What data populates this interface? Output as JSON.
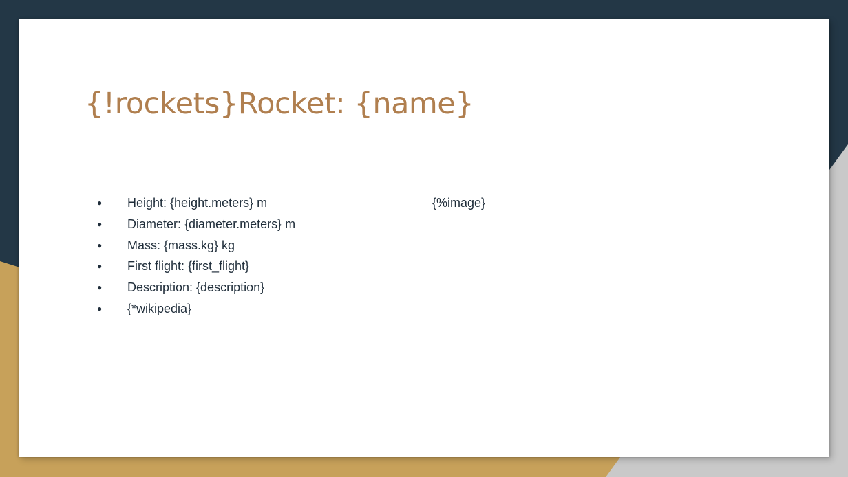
{
  "slide": {
    "title": "{!rockets}Rocket: {name}",
    "bullets": [
      "Height: {height.meters} m",
      "Diameter: {diameter.meters} m",
      "Mass: {mass.kg} kg",
      "First flight: {first_flight}",
      "Description: {description}",
      "{*wikipedia}"
    ],
    "image_placeholder": "{%image}",
    "bullet_glyph": "●"
  },
  "colors": {
    "background_dark": "#233746",
    "accent_gold": "#C7A15A",
    "shadow_gray": "#C9C9C9",
    "title": "#B07F4F",
    "body_text": "#1f2d3a",
    "slide_background": "#ffffff"
  }
}
